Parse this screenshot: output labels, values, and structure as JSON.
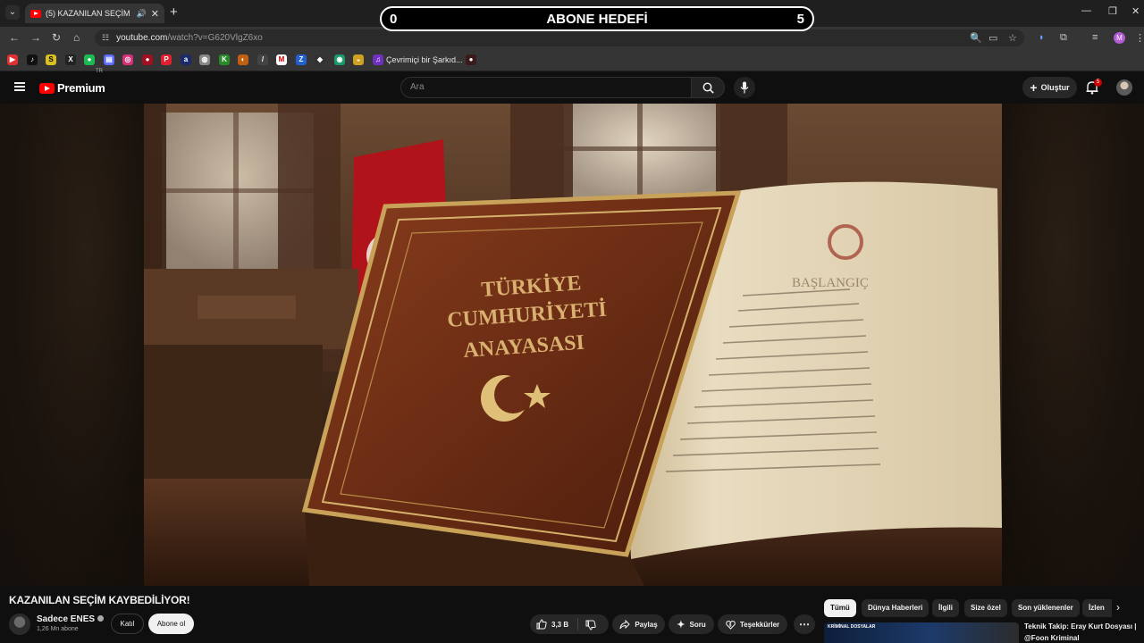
{
  "browser": {
    "tab_title": "(5) KAZANILAN SEÇİM KAYBEDİLİYOR! - YouTube",
    "tab_audio_icon": "speaker-icon",
    "tab_close_icon": "close-icon",
    "new_tab_icon": "plus-icon",
    "url_host": "youtube.com",
    "url_path": "/watch?v=G620VlgZ6xo",
    "profile_initial": "M",
    "bookmark_label": "Çevrimiçi bir Şarkıd..."
  },
  "goal_overlay": {
    "left_value": "0",
    "title": "ABONE HEDEFİ",
    "right_value": "5"
  },
  "youtube": {
    "logo_text": "Premium",
    "logo_region": "TR",
    "search_placeholder": "Ara",
    "create_label": "Oluştur",
    "notification_count": "5"
  },
  "video": {
    "title": "KAZANILAN SEÇİM KAYBEDİLİYOR!",
    "book_title_1": "TÜRKİYE",
    "book_title_2": "CUMHURİYETİ",
    "book_title_3": "ANAYASASI",
    "page_heading": "BAŞLANGIÇ"
  },
  "channel": {
    "name": "Sadece ENES",
    "subscribers": "1,26 Mn abone",
    "join_label": "Katıl",
    "subscribe_label": "Abone ol"
  },
  "actions": {
    "like_count": "3,3 B",
    "share_label": "Paylaş",
    "ask_label": "Soru",
    "thanks_label": "Teşekkürler"
  },
  "chips": [
    "Tümü",
    "Dünya Haberleri",
    "İlgili",
    "Size özel",
    "Son yüklenenler",
    "İzlen"
  ],
  "recommendation": {
    "title_line1": "Teknik Takip: Eray Kurt Dosyası |",
    "title_line2": "@Foon Kriminal",
    "thumb_label": "KRİMİNAL DOSYALAR"
  },
  "colors": {
    "background": "#0f0f0f",
    "brand_red": "#ff0000",
    "chip_bg": "#272727",
    "active_chip": "#f1f1f1"
  }
}
